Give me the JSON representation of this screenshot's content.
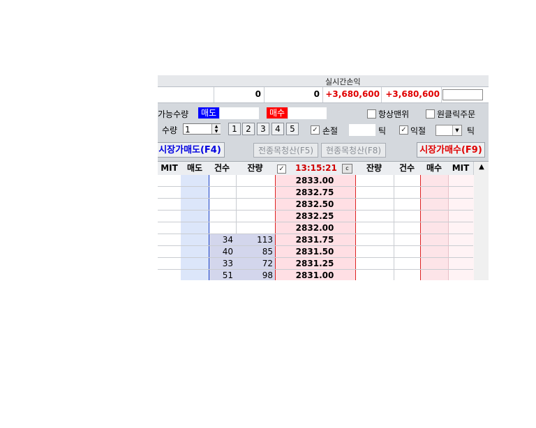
{
  "summary": {
    "header_realtime_pl": "실시간손익",
    "val_qty_a": "0",
    "val_qty_b": "0",
    "val_realtime_pl": "+3,680,600",
    "val_total_pl": "+3,680,600"
  },
  "options": {
    "available_qty_label": "가능수량",
    "sell_tag": "매도",
    "buy_tag": "매수",
    "always_top_label": "항상맨위",
    "one_click_label": "원클릭주문",
    "qty_label": "수량",
    "qty_value": "1",
    "qty_buttons": [
      "1",
      "2",
      "3",
      "4",
      "5"
    ],
    "stop_loss_label": "손절",
    "tick_label_1": "틱",
    "take_profit_label": "익절",
    "tick_label_2": "틱"
  },
  "buttons": {
    "market_sell": "시장가매도(F4)",
    "close_all": "전종목청산(F5)",
    "close_current": "현종목청산(F8)",
    "market_buy": "시장가매수(F9)"
  },
  "table": {
    "headers": {
      "mit_left": "MIT",
      "sell": "매도",
      "count_left": "건수",
      "remain_left": "잔량",
      "time": "13:15:21",
      "c_button": "c",
      "remain_right": "잔량",
      "count_right": "건수",
      "buy": "매수",
      "mit_right": "MIT"
    },
    "rows": [
      {
        "count": "",
        "remain": "",
        "price": "2833.00"
      },
      {
        "count": "",
        "remain": "",
        "price": "2832.75"
      },
      {
        "count": "",
        "remain": "",
        "price": "2832.50"
      },
      {
        "count": "",
        "remain": "",
        "price": "2832.25"
      },
      {
        "count": "",
        "remain": "",
        "price": "2832.00"
      },
      {
        "count": "34",
        "remain": "113",
        "price": "2831.75"
      },
      {
        "count": "40",
        "remain": "85",
        "price": "2831.50"
      },
      {
        "count": "33",
        "remain": "72",
        "price": "2831.25"
      },
      {
        "count": "51",
        "remain": "98",
        "price": "2831.00"
      }
    ]
  },
  "colors": {
    "sell_blue": "#0000ff",
    "buy_red": "#ff0000",
    "sell_col_bg": "#dce6fa",
    "buy_col_bg": "#fde4e8",
    "price_col_bg": "#ffdfe4",
    "bid_qty_bg": "#d3d6ec"
  }
}
